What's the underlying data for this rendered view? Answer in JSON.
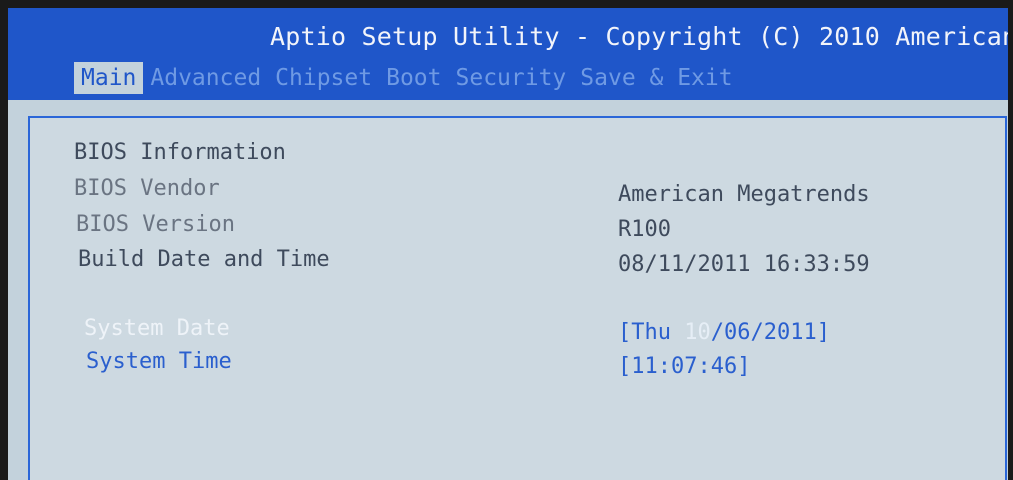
{
  "header": {
    "title": "Aptio Setup Utility - Copyright (C) 2010 American"
  },
  "tabs": [
    {
      "label": "Main",
      "active": true
    },
    {
      "label": "Advanced",
      "active": false
    },
    {
      "label": "Chipset",
      "active": false
    },
    {
      "label": "Boot",
      "active": false
    },
    {
      "label": "Security",
      "active": false
    },
    {
      "label": "Save & Exit",
      "active": false
    }
  ],
  "main": {
    "section_heading": "BIOS Information",
    "bios_vendor": {
      "label": "BIOS Vendor",
      "value": "American Megatrends"
    },
    "bios_version": {
      "label": "BIOS Version",
      "value": "R100"
    },
    "build_date": {
      "label": "Build Date and Time",
      "value": "08/11/2011 16:33:59"
    },
    "system_date": {
      "label": "System Date",
      "value_prefix": "[Thu ",
      "value_selected": "10",
      "value_suffix": "/06/2011]"
    },
    "system_time": {
      "label": "System Time",
      "value": "[11:07:46]"
    }
  },
  "colors": {
    "header_bg": "#1f56c9",
    "panel_bg": "#c3d2dc",
    "accent_blue": "#2a5fce",
    "text_gray": "#3e4a5c"
  }
}
